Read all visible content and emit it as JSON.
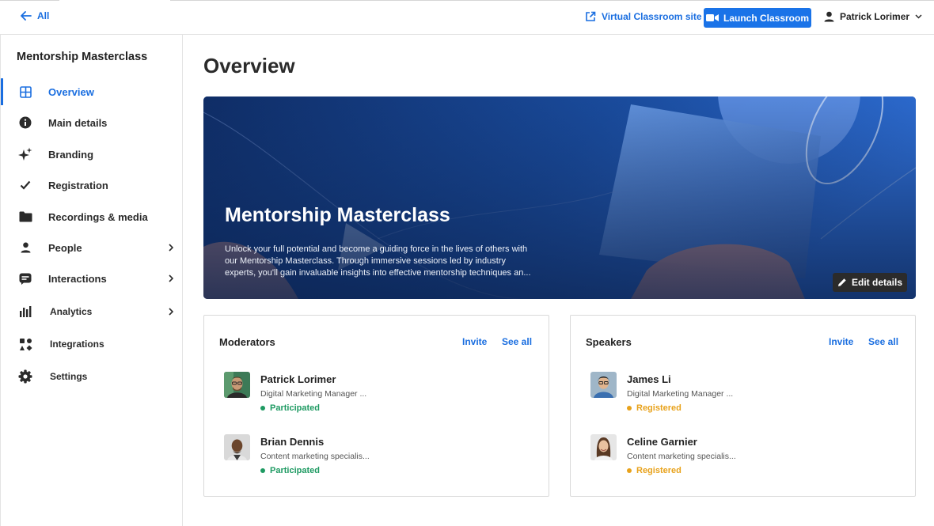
{
  "colors": {
    "accent": "#1a73e8",
    "link": "#1a6ee0",
    "participated": "#1e9a62",
    "registered": "#e8a21b",
    "hero_bg": "#143a7a"
  },
  "topbar": {
    "back_label": "All",
    "virtual_classroom_label": "Virtual Classroom site",
    "launch_label": "Launch Classroom",
    "user_name": "Patrick Lorimer"
  },
  "sidebar": {
    "title": "Mentorship Masterclass",
    "items": [
      {
        "label": "Overview",
        "icon": "grid-icon",
        "active": true,
        "has_chevron": false
      },
      {
        "label": "Main details",
        "icon": "info-icon",
        "active": false,
        "has_chevron": false
      },
      {
        "label": "Branding",
        "icon": "sparkle-icon",
        "active": false,
        "has_chevron": false
      },
      {
        "label": "Registration",
        "icon": "check-icon",
        "active": false,
        "has_chevron": false
      },
      {
        "label": "Recordings & media",
        "icon": "folder-icon",
        "active": false,
        "has_chevron": false
      },
      {
        "label": "People",
        "icon": "person-icon",
        "active": false,
        "has_chevron": true
      },
      {
        "label": "Interactions",
        "icon": "chat-icon",
        "active": false,
        "has_chevron": true
      },
      {
        "label": "Analytics",
        "icon": "bar-chart-icon",
        "active": false,
        "has_chevron": true
      },
      {
        "label": "Integrations",
        "icon": "integrations-icon",
        "active": false,
        "has_chevron": false
      },
      {
        "label": "Settings",
        "icon": "gear-icon",
        "active": false,
        "has_chevron": false
      }
    ]
  },
  "main": {
    "page_title": "Overview",
    "hero": {
      "title": "Mentorship Masterclass",
      "description_lines": [
        "Unlock your full potential and become a guiding force in the lives of others with",
        "our Mentorship Masterclass. Through immersive sessions led by industry",
        "experts, you'll gain invaluable insights into effective mentorship techniques an..."
      ],
      "edit_label": "Edit details"
    },
    "moderators": {
      "title": "Moderators",
      "invite_label": "Invite",
      "see_all_label": "See all",
      "people": [
        {
          "name": "Patrick Lorimer",
          "role": "Digital Marketing Manager ...",
          "status": "Participated"
        },
        {
          "name": "Brian Dennis",
          "role": "Content marketing specialis...",
          "status": "Participated"
        }
      ]
    },
    "speakers": {
      "title": "Speakers",
      "invite_label": "Invite",
      "see_all_label": "See all",
      "people": [
        {
          "name": "James Li",
          "role": "Digital Marketing Manager ...",
          "status": "Registered"
        },
        {
          "name": "Celine Garnier",
          "role": "Content marketing specialis...",
          "status": "Registered"
        }
      ]
    }
  }
}
